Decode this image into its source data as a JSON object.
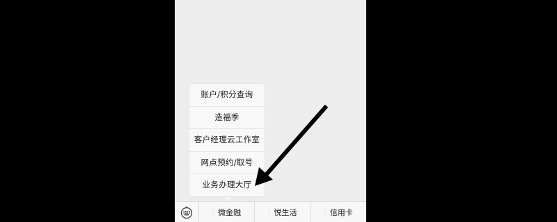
{
  "popup_menu": {
    "items": [
      "账户/积分查询",
      "造福季",
      "客户经理云工作室",
      "网点预约/取号",
      "业务办理大厅"
    ]
  },
  "menu_bar": {
    "keyboard_icon": "keyboard-icon",
    "tabs": [
      "微金融",
      "悦生活",
      "信用卡"
    ]
  },
  "colors": {
    "chat_background": "#ededed",
    "menu_background": "#f7f7f7",
    "popup_background": "#f8f8f8",
    "letterbox": "#000000"
  }
}
